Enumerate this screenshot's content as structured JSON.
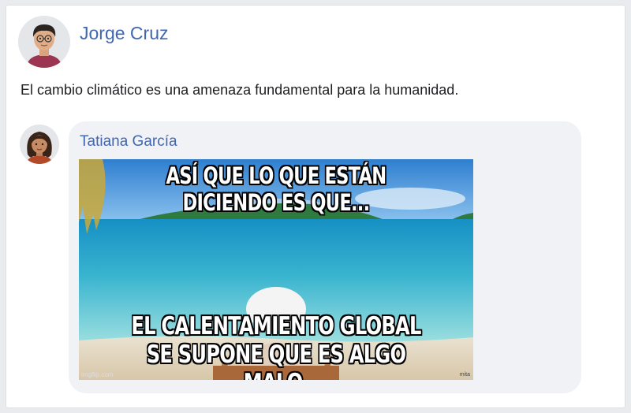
{
  "post": {
    "author": "Jorge Cruz",
    "text": "El cambio climático es una amenaza fundamental para la humanidad."
  },
  "comment": {
    "author": "Tatiana García",
    "meme": {
      "top_text": "ASÍ QUE LO QUE ESTÁN DICIENDO ES QUE...",
      "bottom_line1": "EL CALENTAMIENTO GLOBAL",
      "bottom_line2": "SE SUPONE QUE ES ALGO MALO.",
      "watermark": "imgflip.com",
      "corner_mark": "mita"
    }
  },
  "icons": {
    "post_avatar": "male-avatar-icon",
    "comment_avatar": "female-avatar-icon"
  },
  "colors": {
    "link": "#4267b2",
    "text": "#1c1e21",
    "bubble": "#f0f2f5",
    "page": "#e9ebee"
  }
}
